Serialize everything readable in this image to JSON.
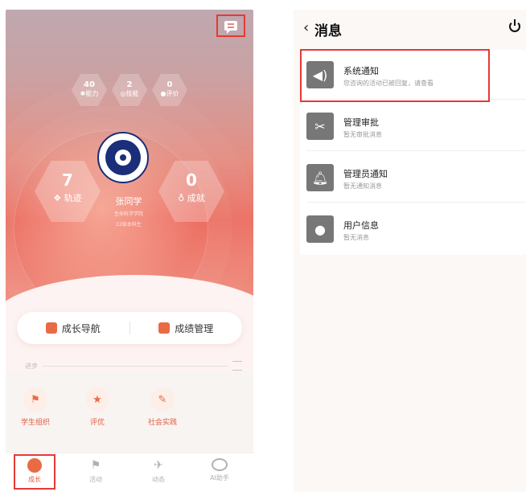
{
  "left": {
    "stats": [
      {
        "value": "40",
        "label": "能力",
        "icon": "star-icon"
      },
      {
        "value": "2",
        "label": "技能",
        "icon": "badge-icon"
      },
      {
        "value": "0",
        "label": "评价",
        "icon": "person-icon"
      }
    ],
    "track": {
      "value": "7",
      "label": "轨迹"
    },
    "achievement": {
      "value": "0",
      "label": "成就"
    },
    "user": {
      "name": "张同学",
      "dept": "生命科学学院",
      "grade": "22级本科生"
    },
    "nav": {
      "growth_nav": "成长导航",
      "grade_mgmt": "成绩管理"
    },
    "steps": {
      "label": "进步"
    },
    "grid": [
      {
        "label": "学生组织",
        "icon": "flag-icon"
      },
      {
        "label": "评优",
        "icon": "trophy-icon"
      },
      {
        "label": "社会实践",
        "icon": "practice-icon"
      }
    ],
    "tabs": [
      {
        "label": "成长",
        "icon": "compass-icon",
        "active": true
      },
      {
        "label": "活动",
        "icon": "flag-icon",
        "active": false
      },
      {
        "label": "动态",
        "icon": "activity-icon",
        "active": false
      },
      {
        "label": "AI助手",
        "icon": "robot-icon",
        "active": false
      }
    ]
  },
  "right": {
    "title": "消息",
    "messages": [
      {
        "title": "系统通知",
        "subtitle": "您咨询的活动已被回复，请查看",
        "icon": "speaker-icon"
      },
      {
        "title": "管理审批",
        "subtitle": "暂无审批消息",
        "icon": "tools-icon"
      },
      {
        "title": "管理员通知",
        "subtitle": "暂无通知消息",
        "icon": "bell-icon"
      },
      {
        "title": "用户信息",
        "subtitle": "暂无消息",
        "icon": "user-icon"
      }
    ]
  },
  "colors": {
    "accent": "#e25d3d",
    "highlight": "#e53935",
    "icon_gray": "#777777"
  }
}
